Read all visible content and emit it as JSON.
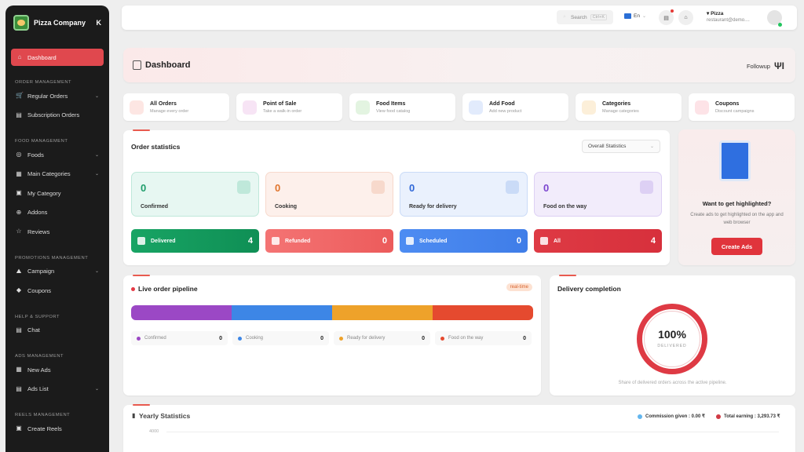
{
  "sidebar": {
    "brand": "Pizza Company",
    "collapse_icon": "K",
    "active": "Dashboard",
    "sections": [
      {
        "title": "ORDER MANAGEMENT",
        "items": [
          {
            "label": "Regular Orders",
            "chev": true
          },
          {
            "label": "Subscription Orders",
            "chev": false
          }
        ]
      },
      {
        "title": "FOOD MANAGEMENT",
        "items": [
          {
            "label": "Foods",
            "chev": true
          },
          {
            "label": "Main Categories",
            "chev": true
          },
          {
            "label": "My Category",
            "chev": false
          },
          {
            "label": "Addons",
            "chev": false
          },
          {
            "label": "Reviews",
            "chev": false
          }
        ]
      },
      {
        "title": "PROMOTIONS MANAGEMENT",
        "items": [
          {
            "label": "Campaign",
            "chev": true
          },
          {
            "label": "Coupons",
            "chev": false
          }
        ]
      },
      {
        "title": "HELP & SUPPORT",
        "items": [
          {
            "label": "Chat",
            "chev": false
          }
        ]
      },
      {
        "title": "ADS MANAGEMENT",
        "items": [
          {
            "label": "New Ads",
            "chev": false
          },
          {
            "label": "Ads List",
            "chev": true
          }
        ]
      },
      {
        "title": "REELS MANAGEMENT",
        "items": [
          {
            "label": "Create Reels",
            "chev": false
          }
        ]
      }
    ]
  },
  "topbar": {
    "search_placeholder": "Search",
    "search_shortcut": "Ctrl+K",
    "language": "En",
    "user_name": "Pizza",
    "user_email": "restaurant@demo...."
  },
  "header": {
    "title": "Dashboard",
    "followup": "Followup"
  },
  "quick_links": [
    {
      "title": "All Orders",
      "sub": "Manage every order",
      "color": "#fde6e3"
    },
    {
      "title": "Point of Sale",
      "sub": "Take a walk-in order",
      "color": "#f7e4f5"
    },
    {
      "title": "Food Items",
      "sub": "View food catalog",
      "color": "#e3f4e1"
    },
    {
      "title": "Add Food",
      "sub": "Add new product",
      "color": "#e2ebfc"
    },
    {
      "title": "Categories",
      "sub": "Manage categories",
      "color": "#fcefd9"
    },
    {
      "title": "Coupons",
      "sub": "Discount campaigns",
      "color": "#fde3e7"
    }
  ],
  "order_stats": {
    "title": "Order statistics",
    "filter": "Overall Statistics",
    "cards": [
      {
        "value": "0",
        "label": "Confirmed",
        "bg": "#e7f7f2",
        "border": "#bfe8da",
        "color": "#1f9d6b"
      },
      {
        "value": "0",
        "label": "Cooking",
        "bg": "#fdf0eb",
        "border": "#f7d9cc",
        "color": "#e0742c"
      },
      {
        "value": "0",
        "label": "Ready for delivery",
        "bg": "#eaf1fd",
        "border": "#cadbf7",
        "color": "#2f67d8"
      },
      {
        "value": "0",
        "label": "Food on the way",
        "bg": "#f2ecfb",
        "border": "#ddd0f4",
        "color": "#7b45cf"
      }
    ],
    "bars": [
      {
        "label": "Delivered",
        "value": "4",
        "bg": "linear-gradient(90deg,#18a464,#0f8f55)"
      },
      {
        "label": "Refunded",
        "value": "0",
        "bg": "linear-gradient(90deg,#f47474,#ec5b5b)"
      },
      {
        "label": "Scheduled",
        "value": "0",
        "bg": "linear-gradient(90deg,#4d8cf2,#3f7de8)"
      },
      {
        "label": "All",
        "value": "4",
        "bg": "linear-gradient(90deg,#de3a44,#d7303c)"
      }
    ]
  },
  "promo": {
    "title": "Want to get highlighted?",
    "text": "Create ads to get highlighted on the app and web browser",
    "button": "Create Ads"
  },
  "pipeline": {
    "title": "Live order pipeline",
    "badge": "real-time",
    "segments": [
      "#9b48c5",
      "#3d86e6",
      "#eea22a",
      "#e54a2f"
    ],
    "legend": [
      {
        "label": "Confirmed",
        "value": "0",
        "color": "#9b48c5"
      },
      {
        "label": "Cooking",
        "value": "0",
        "color": "#3d86e6"
      },
      {
        "label": "Ready for delivery",
        "value": "0",
        "color": "#eea22a"
      },
      {
        "label": "Food on the way",
        "value": "0",
        "color": "#e54a2f"
      }
    ]
  },
  "delivery": {
    "title": "Delivery completion",
    "percent": "100%",
    "label": "DELIVERED",
    "note": "Share of delivered orders across the active pipeline."
  },
  "yearly": {
    "title": "Yearly Statistics",
    "commission": "Commission given : 0.00 ₹",
    "earning": "Total earning : 3,293.73 ₹",
    "y_tick": "4000",
    "commission_color": "#63b6ee",
    "earning_color": "#d03a45"
  }
}
